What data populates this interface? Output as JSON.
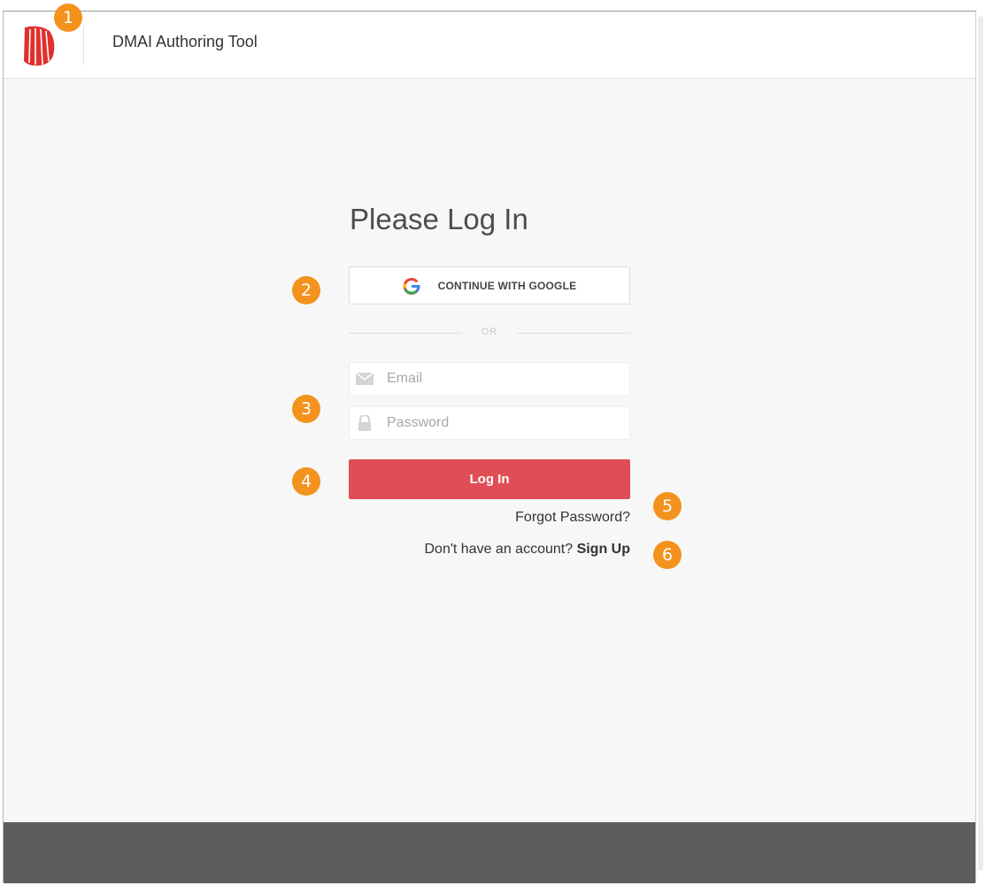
{
  "app": {
    "title": "DMAI Authoring Tool"
  },
  "login": {
    "heading": "Please Log In",
    "google_label": "CONTINUE WITH GOOGLE",
    "divider_text": "OR",
    "email_placeholder": "Email",
    "password_placeholder": "Password",
    "login_label": "Log In",
    "forgot_label": "Forgot Password?",
    "signup_prompt": "Don't have an account?",
    "signup_label": "Sign Up"
  },
  "callouts": [
    "1",
    "2",
    "3",
    "4",
    "5",
    "6"
  ],
  "icons": {
    "logo": "dmai-logo",
    "google": "google-g-icon",
    "email": "envelope-icon",
    "password": "lock-icon"
  },
  "colors": {
    "accent": "#e04e55",
    "callout": "#f4921e",
    "footer": "#5d5d5d",
    "logo": "#e0302d"
  }
}
